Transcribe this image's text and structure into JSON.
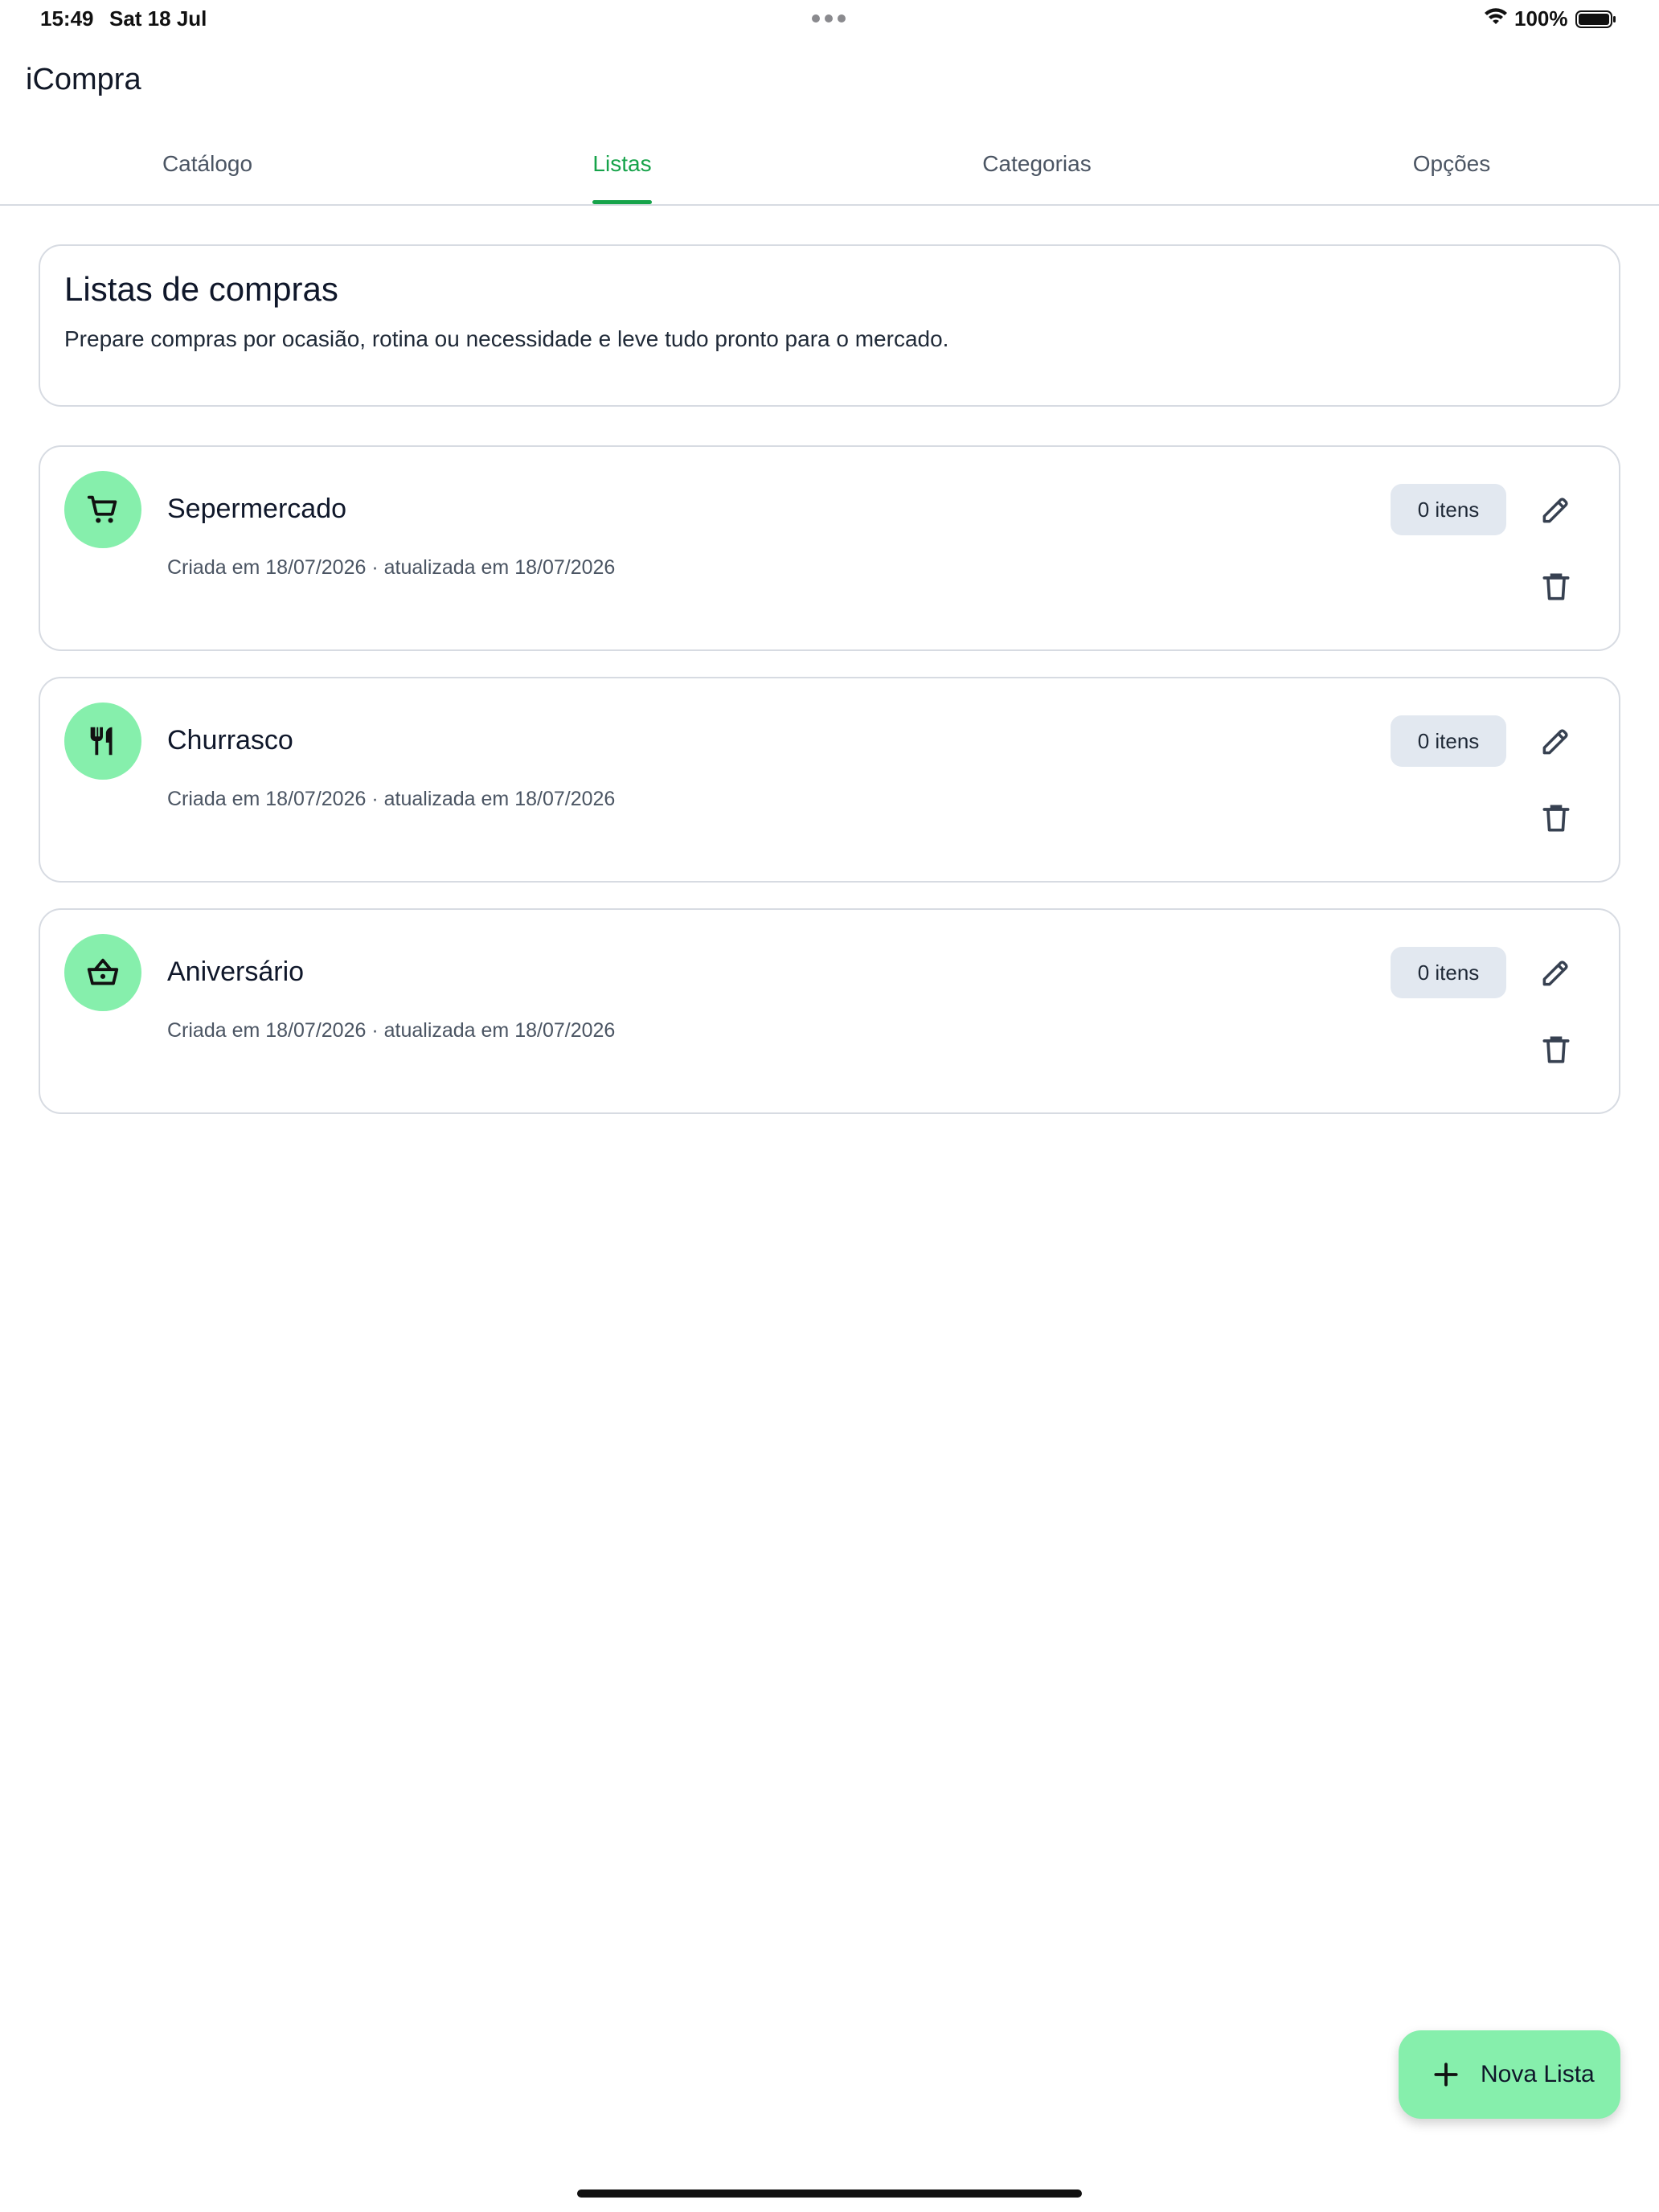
{
  "status_bar": {
    "time": "15:49",
    "date": "Sat 18 Jul",
    "battery_pct": "100%"
  },
  "app": {
    "title": "iCompra"
  },
  "tabs": [
    {
      "label": "Catálogo",
      "active": false
    },
    {
      "label": "Listas",
      "active": true
    },
    {
      "label": "Categorias",
      "active": false
    },
    {
      "label": "Opções",
      "active": false
    }
  ],
  "header": {
    "title": "Listas de compras",
    "subtitle": "Prepare compras por ocasião, rotina ou necessidade e leve tudo pronto para o mercado."
  },
  "lists": [
    {
      "name": "Sepermercado",
      "icon": "cart-icon",
      "meta": "Criada em 18/07/2026 · atualizada em 18/07/2026",
      "count": "0 itens"
    },
    {
      "name": "Churrasco",
      "icon": "utensils-icon",
      "meta": "Criada em 18/07/2026 · atualizada em 18/07/2026",
      "count": "0 itens"
    },
    {
      "name": "Aniversário",
      "icon": "basket-icon",
      "meta": "Criada em 18/07/2026 · atualizada em 18/07/2026",
      "count": "0 itens"
    }
  ],
  "fab": {
    "label": "Nova Lista",
    "icon": "plus-icon"
  },
  "colors": {
    "accent": "#16a34a",
    "icon_bg": "#86efac",
    "badge_bg": "#e2e8f0",
    "border": "#d7dbe2"
  }
}
